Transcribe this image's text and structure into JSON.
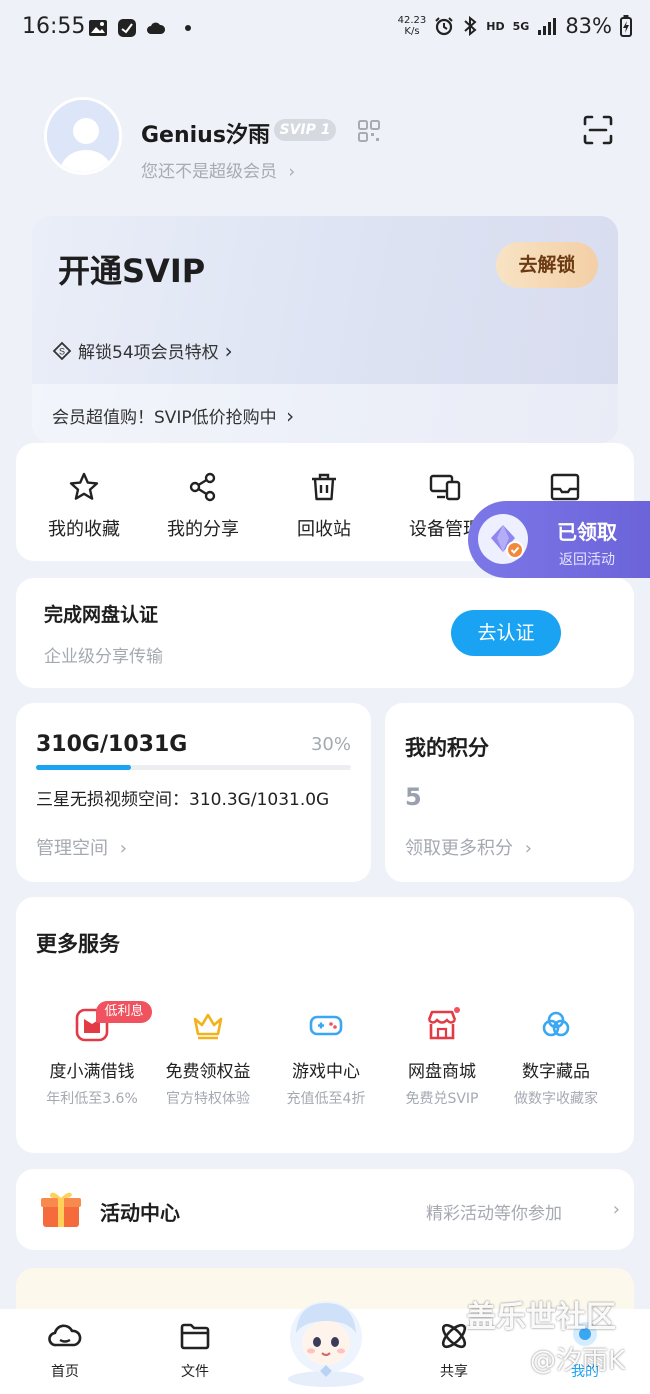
{
  "status_bar": {
    "time": "16:55",
    "net_speed_value": "42.23",
    "net_speed_unit": "K/s",
    "hd_label": "HD",
    "signal_label": "5G",
    "battery": "83%"
  },
  "profile": {
    "username": "Genius汐雨",
    "level_badge": "SVIP 1",
    "membership_note": "您还不是超级会员"
  },
  "svip_card": {
    "title": "开通SVIP",
    "unlock_button": "去解锁",
    "privileges": "解锁54项会员特权",
    "promo": "会员超值购！SVIP低价抢购中"
  },
  "quick_actions": [
    {
      "label": "我的收藏",
      "icon": "star-icon"
    },
    {
      "label": "我的分享",
      "icon": "share-icon"
    },
    {
      "label": "回收站",
      "icon": "trash-icon"
    },
    {
      "label": "设备管理",
      "icon": "devices-icon"
    },
    {
      "label": "",
      "icon": "inbox-icon"
    }
  ],
  "claimed_popup": {
    "title": "已领取",
    "subtitle": "返回活动"
  },
  "verification": {
    "title": "完成网盘认证",
    "subtitle": "企业级分享传输",
    "button": "去认证"
  },
  "storage": {
    "usage": "310G/1031G",
    "percent": "30%",
    "fill_fraction": 0.3,
    "detail": "三星无损视频空间：310.3G/1031.0G",
    "manage_link": "管理空间"
  },
  "points": {
    "title": "我的积分",
    "value": "5",
    "more_link": "领取更多积分"
  },
  "services": {
    "title": "更多服务",
    "tag": "低利息",
    "items": [
      {
        "name": "度小满借钱",
        "desc": "年利低至3.6%",
        "icon": "loan-icon"
      },
      {
        "name": "免费领权益",
        "desc": "官方特权体验",
        "icon": "crown-icon"
      },
      {
        "name": "游戏中心",
        "desc": "充值低至4折",
        "icon": "gamepad-icon"
      },
      {
        "name": "网盘商城",
        "desc": "免费兑SVIP",
        "icon": "store-icon"
      },
      {
        "name": "数字藏品",
        "desc": "做数字收藏家",
        "icon": "cloud-icon"
      }
    ]
  },
  "activity": {
    "title": "活动中心",
    "note": "精彩活动等你参加"
  },
  "bottom_nav": [
    {
      "label": "首页",
      "icon": "home-cloud-icon"
    },
    {
      "label": "文件",
      "icon": "folder-icon"
    },
    {
      "label": "共享",
      "icon": "share-orbit-icon"
    },
    {
      "label": "我的",
      "icon": "profile-icon"
    }
  ],
  "watermark": {
    "line1": "盖乐世社区",
    "line2": "@汐雨K"
  },
  "colors": {
    "accent": "#1aa3f3",
    "popup": "#6c63d9",
    "tag": "#f0535f",
    "background": "#eef1f7"
  }
}
